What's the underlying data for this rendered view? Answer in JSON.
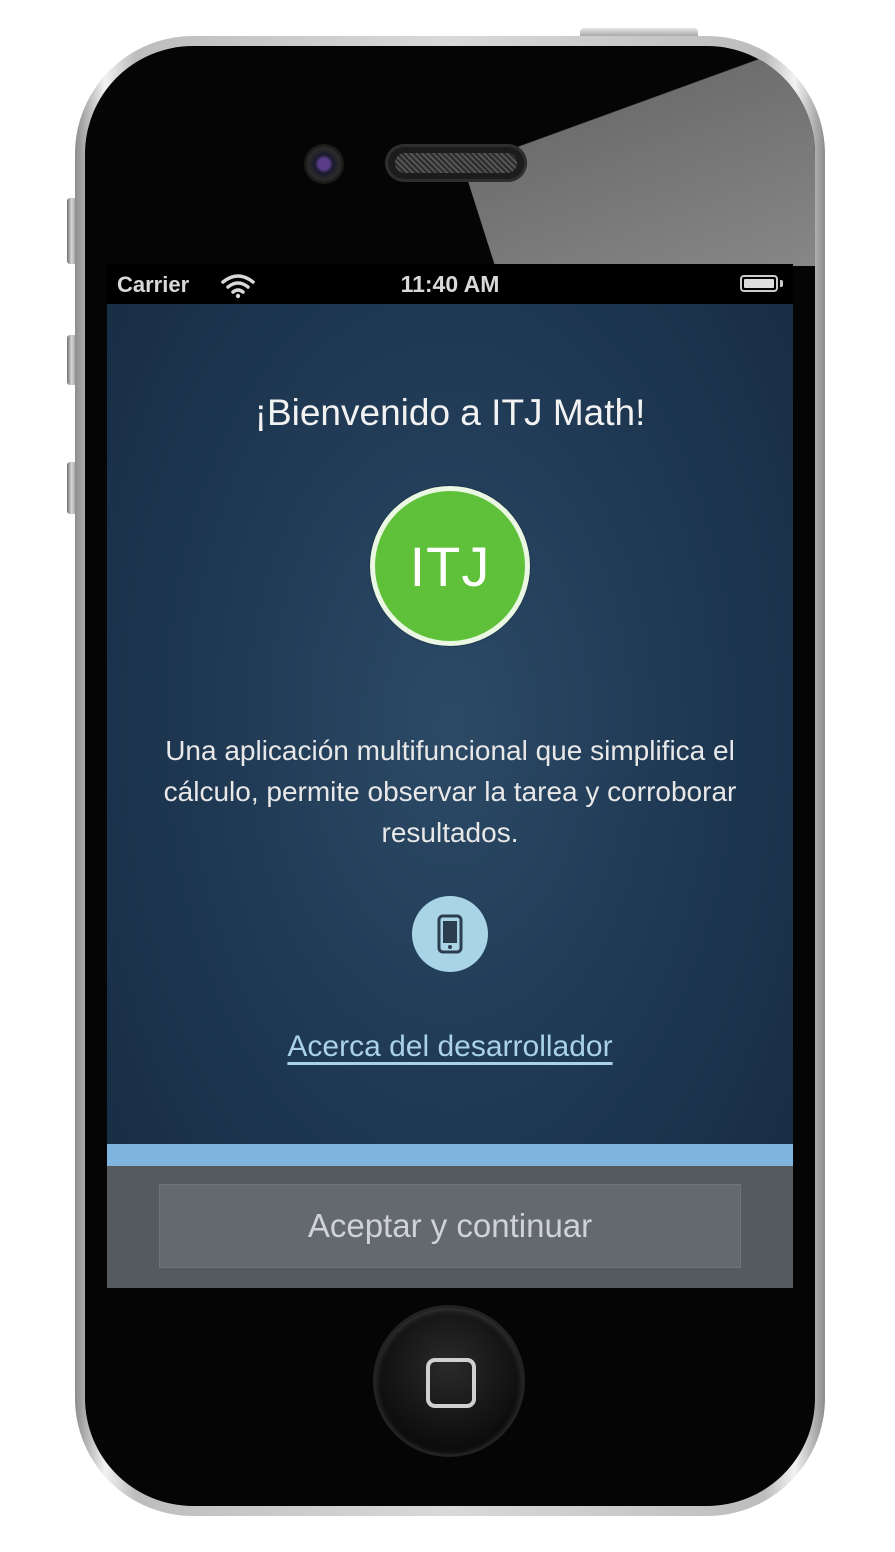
{
  "status_bar": {
    "carrier": "Carrier",
    "time": "11:40 AM",
    "wifi_icon": "wifi-icon",
    "battery_icon": "battery-icon"
  },
  "screen": {
    "title": "¡Bienvenido a ITJ Math!",
    "logo_text": "ITJ",
    "description": "Una aplicación multifuncional que simplifica el cálculo, permite observar la tarea y corroborar resultados.",
    "device_icon": "smartphone-icon",
    "developer_link": "Acerca del desarrollador",
    "accept_button": "Aceptar y continuar"
  },
  "colors": {
    "background": "#203a55",
    "logo_green": "#5fc13a",
    "link": "#a9d2e6",
    "accent_bar": "#7fb4de",
    "button": "#63696e"
  }
}
